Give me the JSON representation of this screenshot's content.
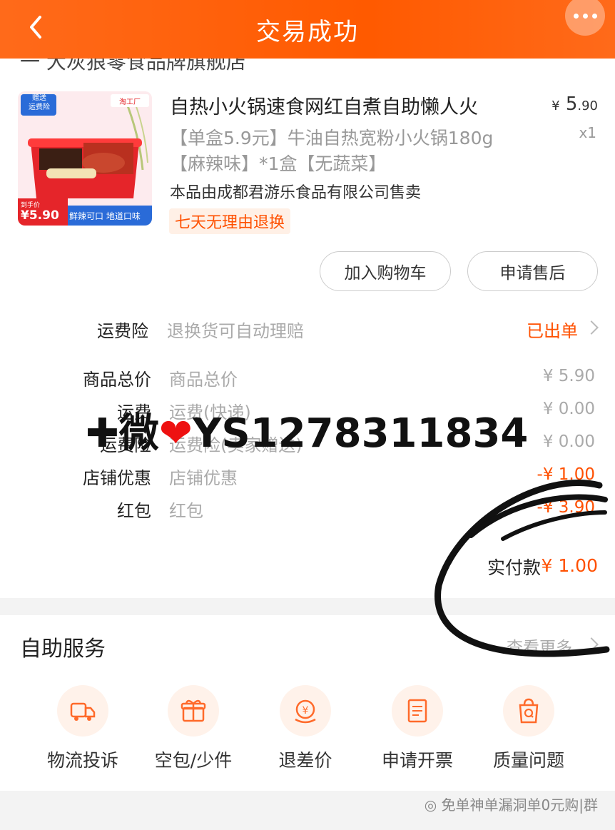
{
  "header": {
    "title": "交易成功"
  },
  "shop_strip": "一 大灰狼零食品牌旗舰店",
  "product": {
    "image": {
      "badge_left": "赠送\n运费险",
      "badge_right": "淘工厂",
      "price_label": "到手价",
      "price": "¥5.90",
      "slogan": "鲜辣可口 地道口味"
    },
    "title": "自热小火锅速食网红自煮自助懒人火",
    "price_symbol": "¥",
    "price_int": "5",
    "price_dec": ".90",
    "qty": "x1",
    "spec": "【单盒5.9元】牛油自热宽粉小火锅180g 【麻辣味】*1盒【无蔬菜】",
    "seller": "本品由成都君游乐食品有限公司售卖",
    "return_tag": "七天无理由退换"
  },
  "actions": {
    "add_cart": "加入购物车",
    "after_sale": "申请售后"
  },
  "insurance": {
    "label": "运费险",
    "desc": "退换货可自动理赔",
    "status": "已出单"
  },
  "summary": [
    {
      "label": "商品总价",
      "desc": "商品总价",
      "value": "¥ 5.90"
    },
    {
      "label": "运费",
      "desc": "运费(快递)",
      "value": "¥ 0.00"
    },
    {
      "label": "运费险",
      "desc": "运费险(卖家赠送)",
      "value": "¥ 0.00"
    },
    {
      "label": "店铺优惠",
      "desc": "店铺优惠",
      "value": "-¥ 1.00"
    },
    {
      "label": "红包",
      "desc": "红包",
      "value": "-¥ 3.90"
    }
  ],
  "paid": {
    "label": "实付款",
    "value": "¥ 1.00"
  },
  "watermark": {
    "prefix": "✚微",
    "heart": "❤",
    "id": "YS1278311834"
  },
  "service": {
    "title": "自助服务",
    "see_more": "查看更多",
    "items": [
      {
        "label": "物流投诉",
        "icon": "truck-icon"
      },
      {
        "label": "空包/少件",
        "icon": "gift-icon"
      },
      {
        "label": "退差价",
        "icon": "refund-icon"
      },
      {
        "label": "申请开票",
        "icon": "invoice-icon"
      },
      {
        "label": "质量问题",
        "icon": "quality-bag-icon"
      }
    ]
  },
  "footer_watermark": "免单神单漏洞单0元购|群",
  "colors": {
    "accent": "#ff5000",
    "header": "#ff5a00"
  }
}
